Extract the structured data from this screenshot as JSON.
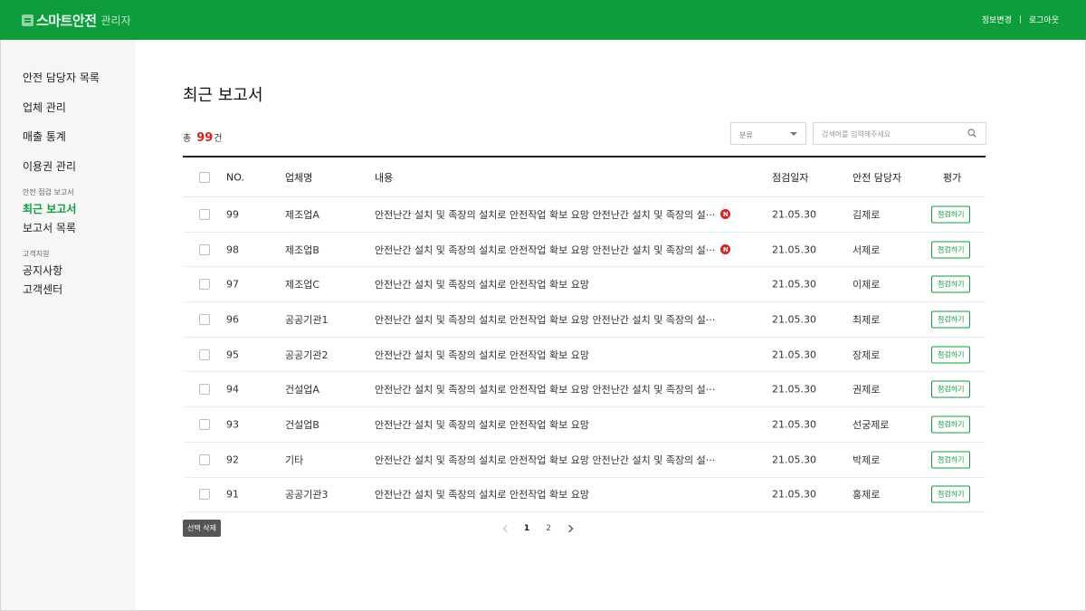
{
  "header": {
    "logo_text": "스마트안전",
    "logo_sub": "관리자",
    "links": [
      "정보변경",
      "로그아웃"
    ]
  },
  "sidebar": {
    "items": [
      "안전 담당자 목록",
      "업체 관리",
      "매출 통계",
      "이용권 관리"
    ],
    "group1": {
      "label": "안전 점검 보고서",
      "items": [
        "최근 보고서",
        "보고서 목록"
      ],
      "active_index": 0
    },
    "group2": {
      "label": "고객지원",
      "items": [
        "공지사항",
        "고객센터"
      ]
    }
  },
  "main": {
    "title": "최근 보고서",
    "total_prefix": "총",
    "total_count": "99",
    "total_suffix": "건",
    "filter": {
      "selected": "분류"
    },
    "search": {
      "placeholder": "검색어를 입력해주세요"
    },
    "table": {
      "headers": [
        "NO.",
        "업체명",
        "내용",
        "점검일자",
        "안전 담당자",
        "평가"
      ],
      "rows": [
        {
          "no": "99",
          "name": "제조업A",
          "content": "안전난간 설치 및 족장의 설치로 안전작업 확보 요망 안전난간 설치 및 족장의 설···",
          "is_new": true,
          "new_label": "N",
          "date": "21.05.30",
          "manager": "김제로",
          "action": "점검하기"
        },
        {
          "no": "98",
          "name": "제조업B",
          "content": "안전난간 설치 및 족장의 설치로 안전작업 확보 요망 안전난간 설치 및 족장의 설···",
          "is_new": true,
          "new_label": "N",
          "date": "21.05.30",
          "manager": "서제로",
          "action": "점검하기"
        },
        {
          "no": "97",
          "name": "제조업C",
          "content": "안전난간 설치 및 족장의 설치로 안전작업 확보 요망",
          "is_new": false,
          "date": "21.05.30",
          "manager": "이제로",
          "action": "점검하기"
        },
        {
          "no": "96",
          "name": "공공기관1",
          "content": "안전난간 설치 및 족장의 설치로 안전작업 확보 요망 안전난간 설치 및 족장의 설···",
          "is_new": false,
          "date": "21.05.30",
          "manager": "최제로",
          "action": "점검하기"
        },
        {
          "no": "95",
          "name": "공공기관2",
          "content": "안전난간 설치 및 족장의 설치로 안전작업 확보 요망",
          "is_new": false,
          "date": "21.05.30",
          "manager": "장제로",
          "action": "점검하기"
        },
        {
          "no": "94",
          "name": "건설업A",
          "content": "안전난간 설치 및 족장의 설치로 안전작업 확보 요망 안전난간 설치 및 족장의 설···",
          "is_new": false,
          "date": "21.05.30",
          "manager": "권제로",
          "action": "점검하기"
        },
        {
          "no": "93",
          "name": "건설업B",
          "content": "안전난간 설치 및 족장의 설치로 안전작업 확보 요망",
          "is_new": false,
          "date": "21.05.30",
          "manager": "선궁제로",
          "action": "점검하기"
        },
        {
          "no": "92",
          "name": "기타",
          "content": "안전난간 설치 및 족장의 설치로 안전작업 확보 요망 안전난간 설치 및 족장의 설···",
          "is_new": false,
          "date": "21.05.30",
          "manager": "박제로",
          "action": "점검하기"
        },
        {
          "no": "91",
          "name": "공공기관3",
          "content": "안전난간 설치 및 족장의 설치로 안전작업 확보 요망",
          "is_new": false,
          "date": "21.05.30",
          "manager": "홍제로",
          "action": "점검하기"
        }
      ]
    },
    "delete_label": "선택 삭제",
    "pagination": {
      "pages": [
        "1",
        "2"
      ],
      "current": "1"
    }
  },
  "colors": {
    "brand": "#0e9c3d",
    "alert": "#d62121"
  },
  "icons": {
    "search": "search-icon",
    "select": "chevron-down-icon",
    "prev": "chevron-left-icon",
    "next": "chevron-right-icon"
  }
}
